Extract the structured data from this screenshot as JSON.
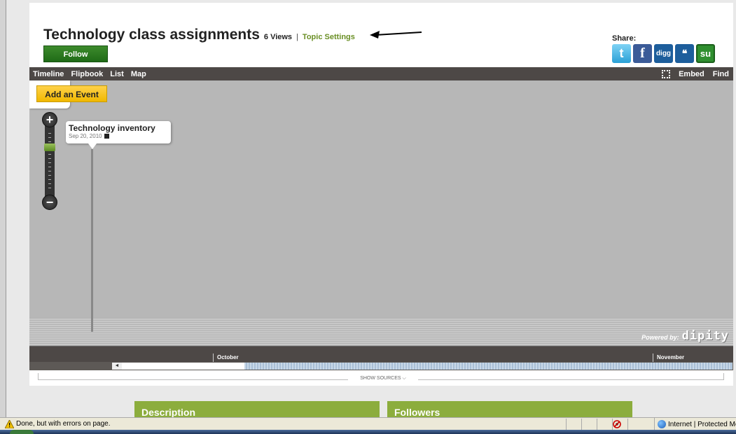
{
  "header": {
    "title": "Technology class assignments",
    "views": "6 Views",
    "separator": "|",
    "topic_settings": "Topic Settings",
    "follow_label": "Follow",
    "share_label": "Share:",
    "share_icons": [
      "twitter-icon",
      "facebook-icon",
      "digg-icon",
      "myspace-icon",
      "stumbleupon-icon"
    ],
    "twitter_glyph": "t",
    "facebook_glyph": "f",
    "digg_glyph": "digg",
    "myspace_glyph": "❝",
    "stumble_glyph": "su"
  },
  "nav": {
    "tabs": [
      {
        "label": "Timeline",
        "active": true
      },
      {
        "label": "Flipbook"
      },
      {
        "label": "List"
      },
      {
        "label": "Map"
      }
    ],
    "embed_label": "Embed",
    "find_label": "Find"
  },
  "timeline": {
    "add_event_label": "Add an Event",
    "zoom_plus": "+",
    "zoom_minus": "−",
    "event": {
      "title": "Technology inventory",
      "date": "Sep 20, 2010"
    },
    "powered_label": "Powered by:",
    "brand": "dipity",
    "months": [
      "October",
      "November"
    ]
  },
  "sources": {
    "label": "SHOW SOURCES ⌵"
  },
  "panels": {
    "description": "Description",
    "followers": "Followers"
  },
  "statusbar": {
    "message": "Done, but with errors on page.",
    "zone": "Internet | Protected Mode: On"
  },
  "colors": {
    "follow_green": "#2a7a20",
    "topic_settings": "#6a8f25",
    "add_event_yellow": "#f5c518",
    "nav_dark": "#4d4846",
    "panel_green": "#8cad3d"
  }
}
